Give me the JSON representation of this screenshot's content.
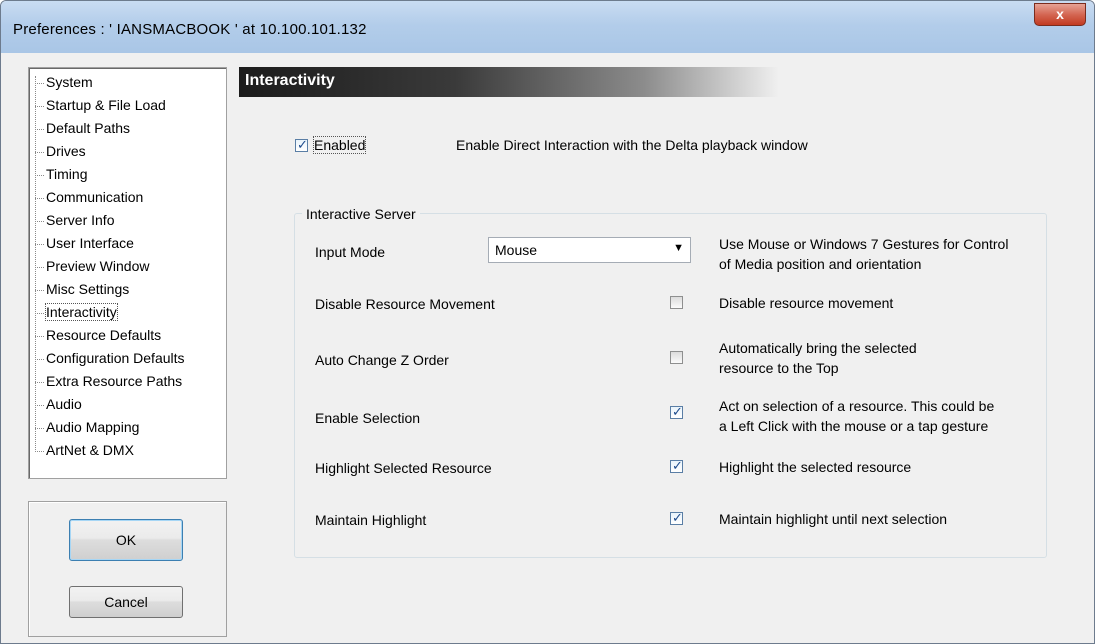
{
  "window": {
    "title": "Preferences  :  ' IANSMACBOOK ' at  10.100.101.132",
    "close_glyph": "x"
  },
  "sidebar": {
    "items": [
      {
        "label": "System"
      },
      {
        "label": "Startup & File Load"
      },
      {
        "label": "Default Paths"
      },
      {
        "label": "Drives"
      },
      {
        "label": "Timing"
      },
      {
        "label": "Communication"
      },
      {
        "label": "Server Info"
      },
      {
        "label": "User Interface"
      },
      {
        "label": "Preview Window"
      },
      {
        "label": "Misc Settings"
      },
      {
        "label": "Interactivity",
        "selected": true
      },
      {
        "label": "Resource Defaults"
      },
      {
        "label": "Configuration Defaults"
      },
      {
        "label": "Extra Resource Paths"
      },
      {
        "label": "Audio"
      },
      {
        "label": "Audio Mapping"
      },
      {
        "label": "ArtNet & DMX"
      }
    ]
  },
  "buttons": {
    "ok_label": "OK",
    "cancel_label": "Cancel"
  },
  "main": {
    "header": "Interactivity",
    "enabled": {
      "label": "Enabled",
      "checked": true,
      "description": "Enable Direct Interaction with the Delta playback window"
    },
    "group_title": "Interactive Server",
    "input_mode": {
      "label": "Input Mode",
      "value": "Mouse",
      "description_line1": "Use Mouse or Windows 7 Gestures for Control",
      "description_line2": "of Media position and orientation"
    },
    "options": [
      {
        "label": "Disable Resource Movement",
        "checked": false,
        "desc1": "Disable resource movement",
        "desc2": ""
      },
      {
        "label": "Auto Change Z Order",
        "checked": false,
        "desc1": "Automatically bring the selected",
        "desc2": "resource to the Top"
      },
      {
        "label": "Enable Selection",
        "checked": true,
        "desc1": "Act on selection of a resource. This could be",
        "desc2": "a Left Click with the mouse or a tap gesture"
      },
      {
        "label": "Highlight Selected Resource",
        "checked": true,
        "desc1": "Highlight the selected resource",
        "desc2": ""
      },
      {
        "label": "Maintain Highlight",
        "checked": true,
        "desc1": "Maintain highlight until next selection",
        "desc2": ""
      }
    ]
  },
  "colors": {
    "title_bar": "#b3cdea",
    "close": "#c23a21",
    "header_bg": "#1c1c1c",
    "check": "#1c4a8c"
  }
}
